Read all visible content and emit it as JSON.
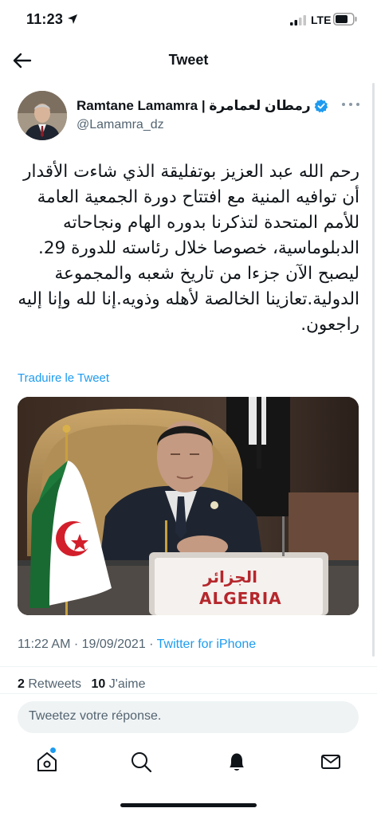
{
  "status_bar": {
    "time": "11:23",
    "network": "LTE"
  },
  "header": {
    "title": "Tweet"
  },
  "author": {
    "name": "Ramtane Lamamra | رمطان لعمامرة",
    "handle": "@Lamamra_dz",
    "verified": true
  },
  "tweet": {
    "text": "رحم الله عبد العزيز بوتفليقة الذي شاءت الأقدار أن توافيه المنية مع افتتاح دورة الجمعية العامة للأمم المتحدة لتذكرنا بدوره الهام ونجاحاته الدبلوماسية، خصوصا خلال رئاسته للدورة 29. ليصبح الآن جزءا من تاريخ شعبه والمجموعة الدولية.تعازينا الخالصة لأهله وذويه.إنا لله وإنا إليه راجعون.",
    "translate_label": "Traduire le Tweet",
    "image_sign": {
      "arabic": "الجزائر",
      "latin": "ALGERIA"
    },
    "time": "11:22 AM",
    "separator": " · ",
    "date": "19/09/2021",
    "source": "Twitter for iPhone"
  },
  "stats": {
    "retweets_count": "2",
    "retweets_label": "Retweets",
    "likes_count": "10",
    "likes_label": "J'aime"
  },
  "reply": {
    "placeholder": "Tweetez votre réponse."
  },
  "nav": {
    "items": [
      "home-icon",
      "search-icon",
      "notifications-icon",
      "messages-icon"
    ],
    "home_has_notification": true
  },
  "colors": {
    "accent": "#1d9bf0",
    "text": "#0f1419",
    "secondary_text": "#536471",
    "sign_red": "#b5272c"
  }
}
